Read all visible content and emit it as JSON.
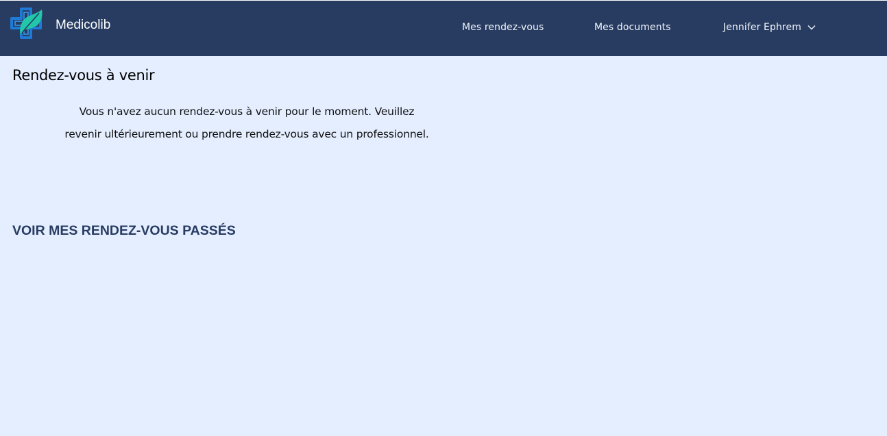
{
  "header": {
    "brand": "Medicolib",
    "nav": {
      "appointments": "Mes rendez-vous",
      "documents": "Mes documents",
      "user": "Jennifer Ephrem"
    }
  },
  "main": {
    "title": "Rendez-vous à venir",
    "empty_message": "Vous n'avez aucun rendez-vous à venir pour le moment. Veuillez revenir ultérieurement ou prendre rendez-vous avec un professionnel.",
    "past_link": "VOIR MES RENDEZ-VOUS PASSÉS"
  },
  "colors": {
    "navbar": "#283c62",
    "background": "#e4eeff",
    "accent_link": "#283c62",
    "logo_blue": "#1f7ad6",
    "logo_teal": "#22c7a9"
  },
  "icons": {
    "logo": "medical-cross-leaf-icon",
    "user_menu": "chevron-down-icon"
  }
}
